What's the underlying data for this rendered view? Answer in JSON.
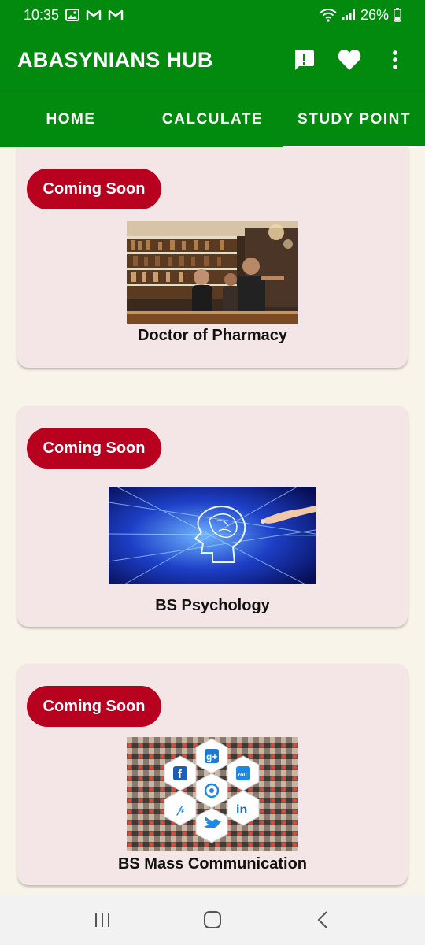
{
  "status": {
    "time": "10:35",
    "battery": "26%",
    "icons": [
      "image-icon",
      "gmail-icon",
      "gmail-icon",
      "wifi-icon",
      "signal-icon",
      "battery-icon"
    ]
  },
  "app_bar": {
    "title": "ABASYNIANS HUB",
    "actions": [
      "feedback-icon",
      "favorite-icon",
      "more-vert-icon"
    ]
  },
  "tabs": [
    {
      "label": "HOME",
      "active": false
    },
    {
      "label": "CALCULATE",
      "active": false
    },
    {
      "label": "STUDY POINT",
      "active": true
    }
  ],
  "cards": [
    {
      "badge": "Coming Soon",
      "title": "Doctor of Pharmacy",
      "image": "pharmacy-photo"
    },
    {
      "badge": "Coming Soon",
      "title": "BS Psychology",
      "image": "psychology-brain-image"
    },
    {
      "badge": "Coming Soon",
      "title": "BS Mass Communication",
      "image": "social-media-collage"
    }
  ],
  "colors": {
    "primary": "#028a0f",
    "badge": "#b8001f",
    "card_bg": "#f4e6e6",
    "page_bg": "#f8f4e9"
  },
  "nav": [
    "recent-apps-icon",
    "home-icon",
    "back-icon"
  ]
}
